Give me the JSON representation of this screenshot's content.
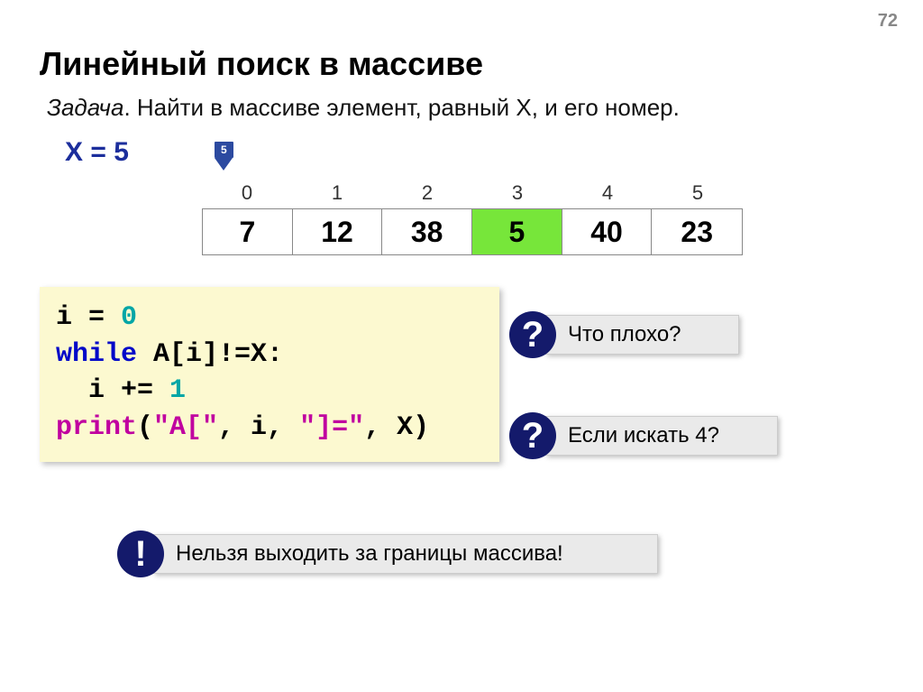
{
  "page_number": "72",
  "title": "Линейный поиск в массиве",
  "task_prefix": "Задача",
  "task_text": ". Найти в массиве элемент, равный X, и его номер.",
  "x_eq": "X = 5",
  "marker_value": "5",
  "array": {
    "indices": [
      "0",
      "1",
      "2",
      "3",
      "4",
      "5"
    ],
    "values": [
      "7",
      "12",
      "38",
      "5",
      "40",
      "23"
    ],
    "highlight_index": 3
  },
  "code": {
    "line1_a": "i = ",
    "line1_num": "0",
    "line2_kw": "while",
    "line2_rest": " A[i]!=X:",
    "line3_a": "  i += ",
    "line3_num": "1",
    "line4_func": "print",
    "line4_open": "(",
    "line4_str1": "\"A[\"",
    "line4_mid1": ", i, ",
    "line4_str2": "\"]=\"",
    "line4_mid2": ", X)"
  },
  "callouts": {
    "q_symbol": "?",
    "bang_symbol": "!",
    "c1": "Что плохо?",
    "c2": "Если искать 4?",
    "c3": "Нельзя выходить за границы массива!"
  }
}
